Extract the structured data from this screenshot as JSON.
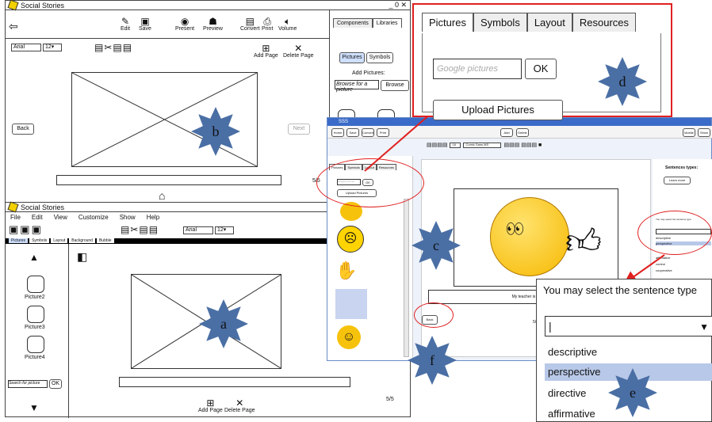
{
  "win_b": {
    "title": "Social Stories",
    "win_ctrl": "_ 0 ✕",
    "tools": {
      "edit": "Edit",
      "save": "Save",
      "present": "Present",
      "preview": "Preview",
      "convert": "Convert",
      "print": "Print",
      "volume": "Volume"
    },
    "font": "Arial",
    "size": "12",
    "add_page": "Add Page",
    "delete_page": "Delete Page",
    "back": "Back",
    "next": "Next",
    "page_num": "5/5",
    "panel_tabs": [
      "Components",
      "Libraries"
    ],
    "pictures": "Pictures",
    "symbols": "Symbols",
    "add_pictures": "Add Pictures:",
    "browse_placeholder": "Browse for a picture",
    "browse": "Browse"
  },
  "win_a": {
    "title": "Social Stories",
    "menu": [
      "File",
      "Edit",
      "View",
      "Customize",
      "Show",
      "Help"
    ],
    "font": "Arial",
    "size": "12",
    "tabs": [
      "Pictures",
      "Symbols",
      "Layout",
      "Background",
      "Bubble"
    ],
    "pictures": [
      "Picture2",
      "Picture3",
      "Picture4"
    ],
    "search_placeholder": "Search for picture",
    "ok": "OK",
    "page_num": "5/5",
    "add_page": "Add Page",
    "delete_page": "Delete Page"
  },
  "zoom_d": {
    "tabs": [
      "Pictures",
      "Symbols",
      "Layout",
      "Resources"
    ],
    "placeholder": "Google pictures",
    "ok": "OK",
    "upload": "Upload Pictures"
  },
  "app_c": {
    "title": "SSS",
    "tools": [
      "Home",
      "Save",
      "Convert",
      "Print",
      "Add",
      "Delete"
    ],
    "right_tools": [
      "Mobile",
      "Show"
    ],
    "font": "Comic Sans MS",
    "size": "16",
    "tabs": [
      "Pictures",
      "Symbols",
      "Layout",
      "Resources"
    ],
    "placeholder": "Google pictures",
    "ok": "OK",
    "upload": "Upload Pictures",
    "sentence_types_title": "Sentences types:",
    "learn_more": "Learn more",
    "select_hint": "You may select the sentence type",
    "types": [
      "descriptive",
      "perspective",
      "affirmative",
      "control",
      "cooperative"
    ],
    "caption": "My teacher is happy when I",
    "back": "Back",
    "page": "5/5"
  },
  "zoom_e": {
    "hint": "You may select the sentence type",
    "types": [
      "descriptive",
      "perspective",
      "directive",
      "affirmative"
    ]
  },
  "callouts": {
    "a": "a",
    "b": "b",
    "c": "c",
    "d": "d",
    "e": "e",
    "f": "f"
  },
  "colors": {
    "callout": "#4a6fa5",
    "highlight": "#e02020",
    "selected": "#b8c8e8"
  }
}
